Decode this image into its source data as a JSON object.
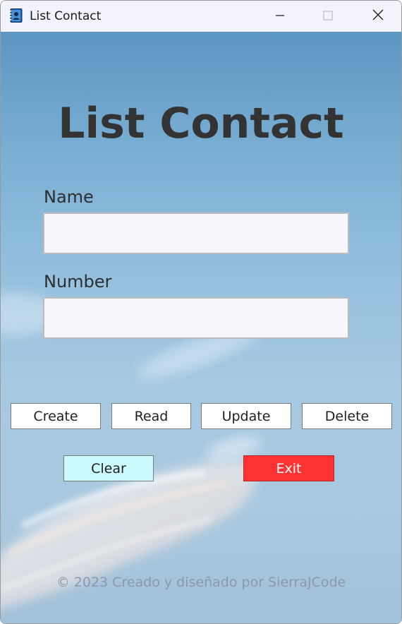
{
  "window": {
    "title": "List Contact",
    "icon": "contact-book-icon",
    "controls": {
      "minimize": "minimize-icon",
      "maximize": "maximize-icon",
      "close": "close-icon"
    }
  },
  "main": {
    "heading": "List Contact",
    "fields": {
      "name_label": "Name",
      "name_value": "",
      "number_label": "Number",
      "number_value": ""
    },
    "buttons": {
      "create": "Create",
      "read": "Read",
      "update": "Update",
      "delete": "Delete",
      "clear": "Clear",
      "exit": "Exit"
    },
    "footer": "© 2023 Creado y diseñado por SierraJCode"
  },
  "colors": {
    "heading_text": "#333333",
    "clear_button_bg": "#ccfbff",
    "exit_button_bg": "#ff3333",
    "exit_button_text": "#ffffff",
    "footer_text": "#8c98a8",
    "field_bg": "#f6f7fa"
  }
}
